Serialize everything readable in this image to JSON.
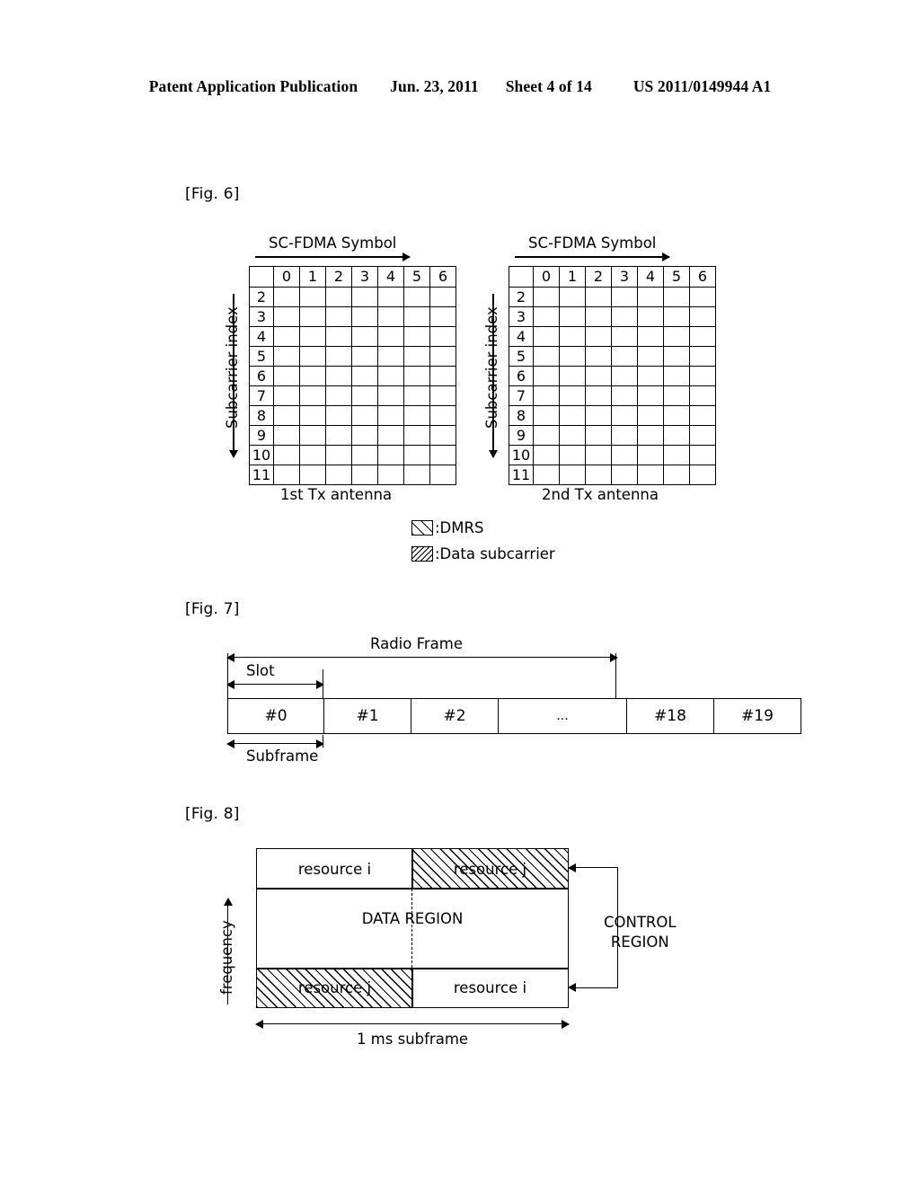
{
  "header": {
    "publication": "Patent Application Publication",
    "date": "Jun. 23, 2011",
    "sheet": "Sheet 4 of 14",
    "doc_number": "US 2011/0149944 A1"
  },
  "fig6": {
    "label": "[Fig. 6]",
    "symbol_axis_title": "SC-FDMA Symbol",
    "subcarrier_axis_title": "Subcarrier index",
    "column_headers": [
      "0",
      "1",
      "2",
      "3",
      "4",
      "5",
      "6"
    ],
    "row_headers": [
      "2",
      "3",
      "4",
      "5",
      "6",
      "7",
      "8",
      "9",
      "10",
      "11"
    ],
    "antenna1_caption": "1st Tx antenna",
    "antenna2_caption": "2nd Tx antenna",
    "legend": [
      {
        "swatch": "dmrs",
        "text": ":DMRS"
      },
      {
        "swatch": "data",
        "text": ":Data subcarrier"
      }
    ],
    "antenna1_cells": [
      [
        "",
        "data",
        "",
        "dmrs",
        "data",
        "",
        "data"
      ],
      [
        "data",
        "",
        "data",
        "dmrs",
        "",
        "data",
        ""
      ],
      [
        "",
        "data",
        "",
        "dmrs",
        "data",
        "",
        "data"
      ],
      [
        "data",
        "",
        "data",
        "dmrs",
        "",
        "data",
        ""
      ],
      [
        "",
        "data",
        "",
        "dmrs",
        "data",
        "",
        "data"
      ],
      [
        "data",
        "",
        "data",
        "dmrs",
        "",
        "data",
        ""
      ],
      [
        "",
        "data",
        "",
        "dmrs",
        "data",
        "",
        "data"
      ],
      [
        "data",
        "",
        "data",
        "dmrs",
        "",
        "data",
        ""
      ],
      [
        "",
        "data",
        "",
        "dmrs",
        "data",
        "",
        "data"
      ],
      [
        "data",
        "",
        "data",
        "dmrs",
        "",
        "data",
        ""
      ]
    ],
    "antenna2_cells": [
      [
        "data",
        "",
        "data",
        "dmrs",
        "",
        "data",
        ""
      ],
      [
        "",
        "data",
        "",
        "dmrs",
        "data",
        "",
        "data"
      ],
      [
        "data",
        "",
        "data",
        "dmrs",
        "",
        "data",
        ""
      ],
      [
        "",
        "data",
        "",
        "dmrs",
        "data",
        "",
        "data"
      ],
      [
        "data",
        "",
        "data",
        "dmrs",
        "",
        "data",
        ""
      ],
      [
        "",
        "data",
        "",
        "dmrs",
        "data",
        "",
        "data"
      ],
      [
        "data",
        "",
        "data",
        "dmrs",
        "",
        "data",
        ""
      ],
      [
        "",
        "data",
        "",
        "dmrs",
        "data",
        "",
        "data"
      ],
      [
        "data",
        "",
        "data",
        "dmrs",
        "",
        "data",
        ""
      ],
      [
        "",
        "data",
        "",
        "dmrs",
        "data",
        "",
        "data"
      ]
    ]
  },
  "fig7": {
    "label": "[Fig. 7]",
    "radio_frame_label": "Radio Frame",
    "slot_label": "Slot",
    "subframe_label": "Subframe",
    "slots": [
      "#0",
      "#1",
      "#2",
      "...",
      "#18",
      "#19"
    ]
  },
  "fig8": {
    "label": "[Fig. 8]",
    "frequency_label": "frequency",
    "subframe_label": "1 ms subframe",
    "control_region_label_line1": "CONTROL",
    "control_region_label_line2": "REGION",
    "data_region_label": "DATA REGION",
    "top_left_label": "resource i",
    "top_right_label": "resource j",
    "bottom_left_label": "resource j",
    "bottom_right_label": "resource i"
  }
}
